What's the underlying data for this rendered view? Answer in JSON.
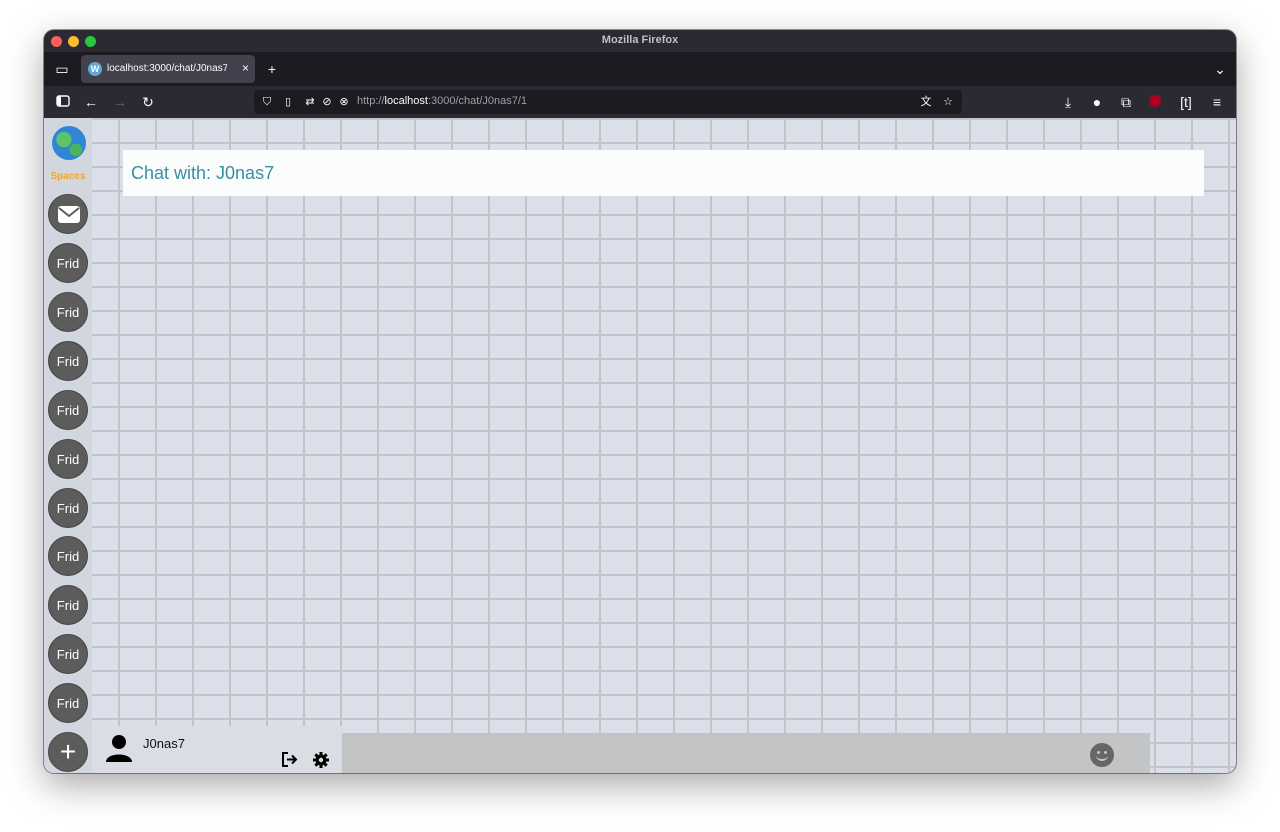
{
  "window": {
    "title": "Mozilla Firefox"
  },
  "tab": {
    "label": "localhost:3000/chat/J0nas7/1",
    "close": "×"
  },
  "toolbar": {
    "new_tab": "+",
    "list_tabs": "⌄"
  },
  "url": {
    "scheme": "http://",
    "host": "localhost",
    "path": ":3000/chat/J0nas7/1"
  },
  "sidebar": {
    "label": "Spaces",
    "items": [
      "Frid",
      "Frid",
      "Frid",
      "Frid",
      "Frid",
      "Frid",
      "Frid",
      "Frid",
      "Frid",
      "Frid"
    ],
    "add": "+"
  },
  "chat": {
    "title": "Chat with: J0nas7"
  },
  "user": {
    "name": "J0nas7"
  }
}
